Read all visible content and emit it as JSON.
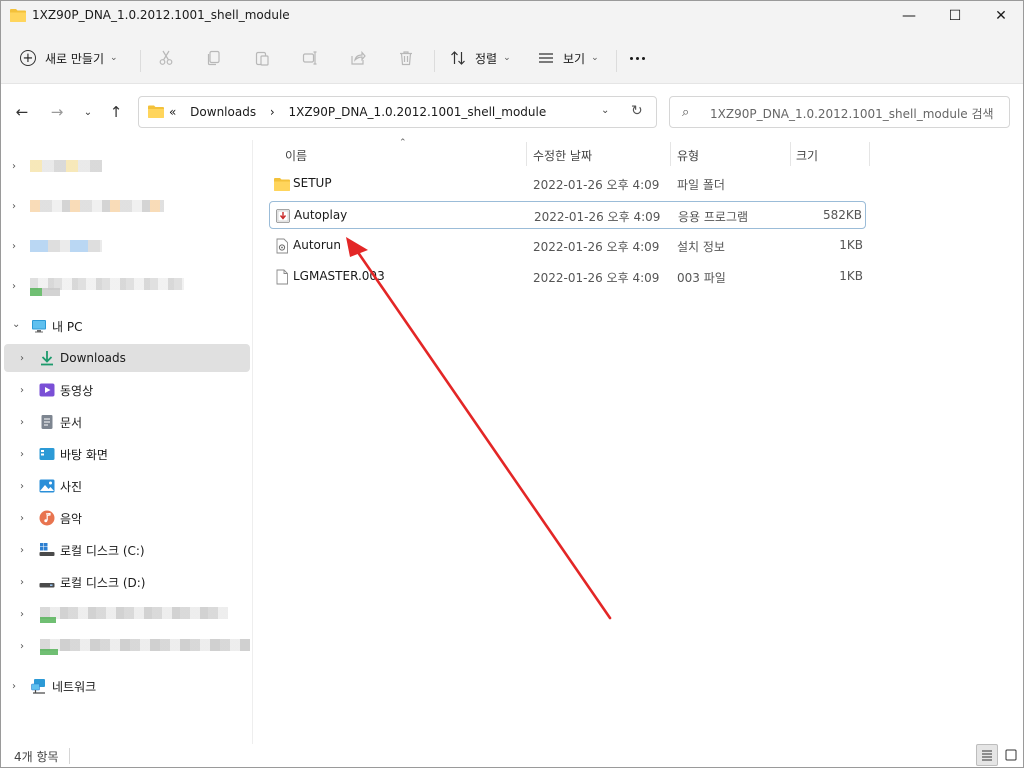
{
  "window": {
    "title": "1XZ90P_DNA_1.0.2012.1001_shell_module",
    "minimize_glyph": "—",
    "maximize_glyph": "☐",
    "close_glyph": "✕"
  },
  "toolbar": {
    "new_label": "새로 만들기",
    "sort_label": "정렬",
    "view_label": "보기"
  },
  "address": {
    "chevrons": "«",
    "crumbs": [
      "Downloads",
      "›",
      "1XZ90P_DNA_1.0.2012.1001_shell_module"
    ],
    "search_placeholder": "1XZ90P_DNA_1.0.2012.1001_shell_module 검색"
  },
  "sidebar": {
    "this_pc": "내 PC",
    "items": [
      {
        "label": "Downloads",
        "icon": "download-icon"
      },
      {
        "label": "동영상",
        "icon": "video-icon"
      },
      {
        "label": "문서",
        "icon": "document-icon"
      },
      {
        "label": "바탕 화면",
        "icon": "desktop-icon"
      },
      {
        "label": "사진",
        "icon": "pictures-icon"
      },
      {
        "label": "음악",
        "icon": "music-icon"
      },
      {
        "label": "로컬 디스크 (C:)",
        "icon": "windows-drive-icon"
      },
      {
        "label": "로컬 디스크 (D:)",
        "icon": "drive-icon"
      }
    ],
    "network": "네트워크"
  },
  "columns": {
    "name": "이름",
    "date": "수정한 날짜",
    "type": "유형",
    "size": "크기"
  },
  "files": [
    {
      "name": "SETUP",
      "date": "2022-01-26 오후 4:09",
      "type": "파일 폴더",
      "size": "",
      "icon": "folder-icon"
    },
    {
      "name": "Autoplay",
      "date": "2022-01-26 오후 4:09",
      "type": "응용 프로그램",
      "size": "582KB",
      "icon": "installer-icon"
    },
    {
      "name": "Autorun",
      "date": "2022-01-26 오후 4:09",
      "type": "설치 정보",
      "size": "1KB",
      "icon": "settings-file-icon"
    },
    {
      "name": "LGMASTER.003",
      "date": "2022-01-26 오후 4:09",
      "type": "003 파일",
      "size": "1KB",
      "icon": "file-icon"
    }
  ],
  "status": {
    "count": "4개 항목"
  },
  "colors": {
    "accent": "#0067c0",
    "folder": "#f3c13a",
    "annotation_arrow": "#e32626",
    "selection": "#e0e0e0"
  }
}
